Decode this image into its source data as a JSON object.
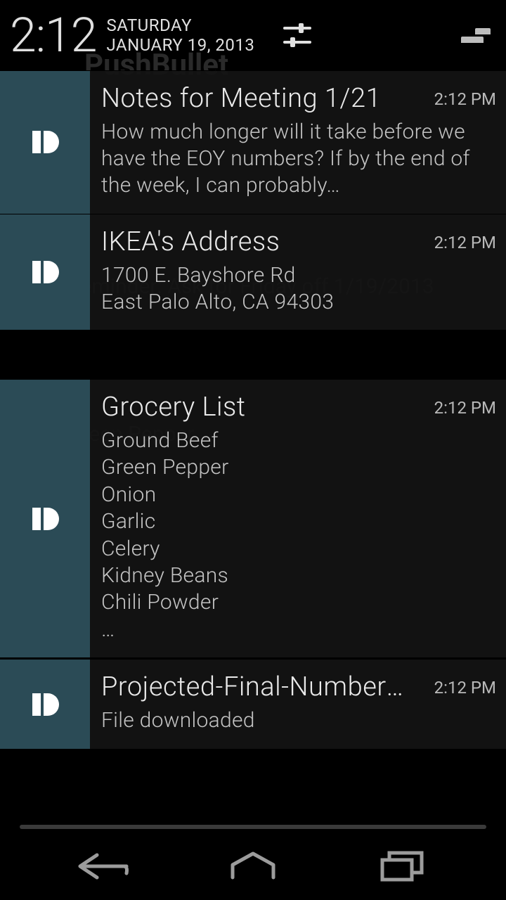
{
  "status": {
    "time": "2:12",
    "day_of_week": "SATURDAY",
    "date": "JANUARY 19, 2013"
  },
  "colors": {
    "notif_icon_bg": "#2b4b56",
    "text_primary": "#eaeaea",
    "text_secondary": "#c4c4c4"
  },
  "notifications": [
    {
      "app_icon": "pushbullet-icon",
      "title": "Notes for Meeting 1/21",
      "timestamp": "2:12 PM",
      "lines": [
        "How much longer will it take before we have the EOY numbers? If by the end of the week, I can probably…"
      ]
    },
    {
      "app_icon": "pushbullet-icon",
      "title": "IKEA's Address",
      "timestamp": "2:12 PM",
      "lines": [
        "1700 E. Bayshore Rd",
        "East Palo Alto, CA 94303"
      ]
    },
    {
      "app_icon": "pushbullet-icon",
      "title": "Grocery List",
      "timestamp": "2:12 PM",
      "lines": [
        "Ground Beef",
        "Green Pepper",
        "Onion",
        "Garlic",
        "Celery",
        "Kidney Beans",
        "Chili Powder",
        "…"
      ]
    },
    {
      "app_icon": "pushbullet-icon",
      "title": "Projected-Final-Numbers-E..",
      "timestamp": "2:12 PM",
      "lines": [
        "File downloaded"
      ]
    }
  ],
  "background_hints": {
    "app_title": "PushBullet",
    "peek1": "Reminder: Ask for Friday off 1/19/2013",
    "peek2": "Green Pepper"
  }
}
